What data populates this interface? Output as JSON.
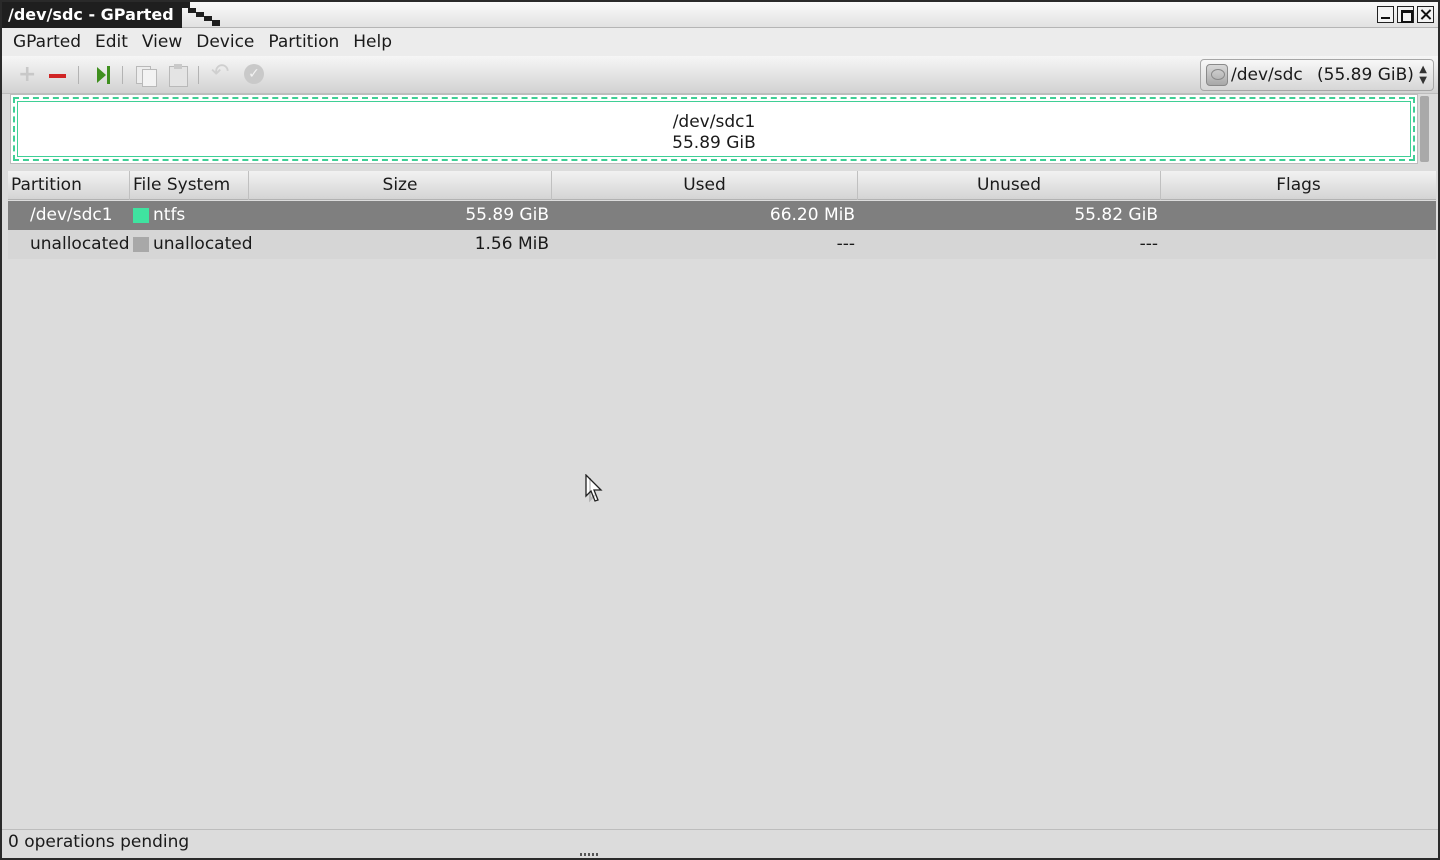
{
  "window": {
    "title": "/dev/sdc - GParted"
  },
  "menubar": {
    "items": [
      "GParted",
      "Edit",
      "View",
      "Device",
      "Partition",
      "Help"
    ]
  },
  "toolbar": {
    "icons": [
      "new-partition-icon",
      "delete-partition-icon",
      "resize-move-icon",
      "copy-icon",
      "paste-icon",
      "undo-icon",
      "apply-icon"
    ],
    "device_selector": {
      "device": "/dev/sdc",
      "size": "(55.89 GiB)"
    }
  },
  "partition_map": {
    "name": "/dev/sdc1",
    "size": "55.89 GiB",
    "color": "#3fcf95"
  },
  "table": {
    "columns": [
      "Partition",
      "File System",
      "Size",
      "Used",
      "Unused",
      "Flags"
    ],
    "rows": [
      {
        "partition": "/dev/sdc1",
        "fs": "ntfs",
        "fs_color": "#3fe3a0",
        "size": "55.89 GiB",
        "used": "66.20 MiB",
        "unused": "55.82 GiB",
        "flags": "",
        "selected": true
      },
      {
        "partition": "unallocated",
        "fs": "unallocated",
        "fs_color": "#a8a8a8",
        "size": "1.56 MiB",
        "used": "---",
        "unused": "---",
        "flags": "",
        "selected": false
      }
    ]
  },
  "statusbar": {
    "text": "0 operations pending"
  }
}
